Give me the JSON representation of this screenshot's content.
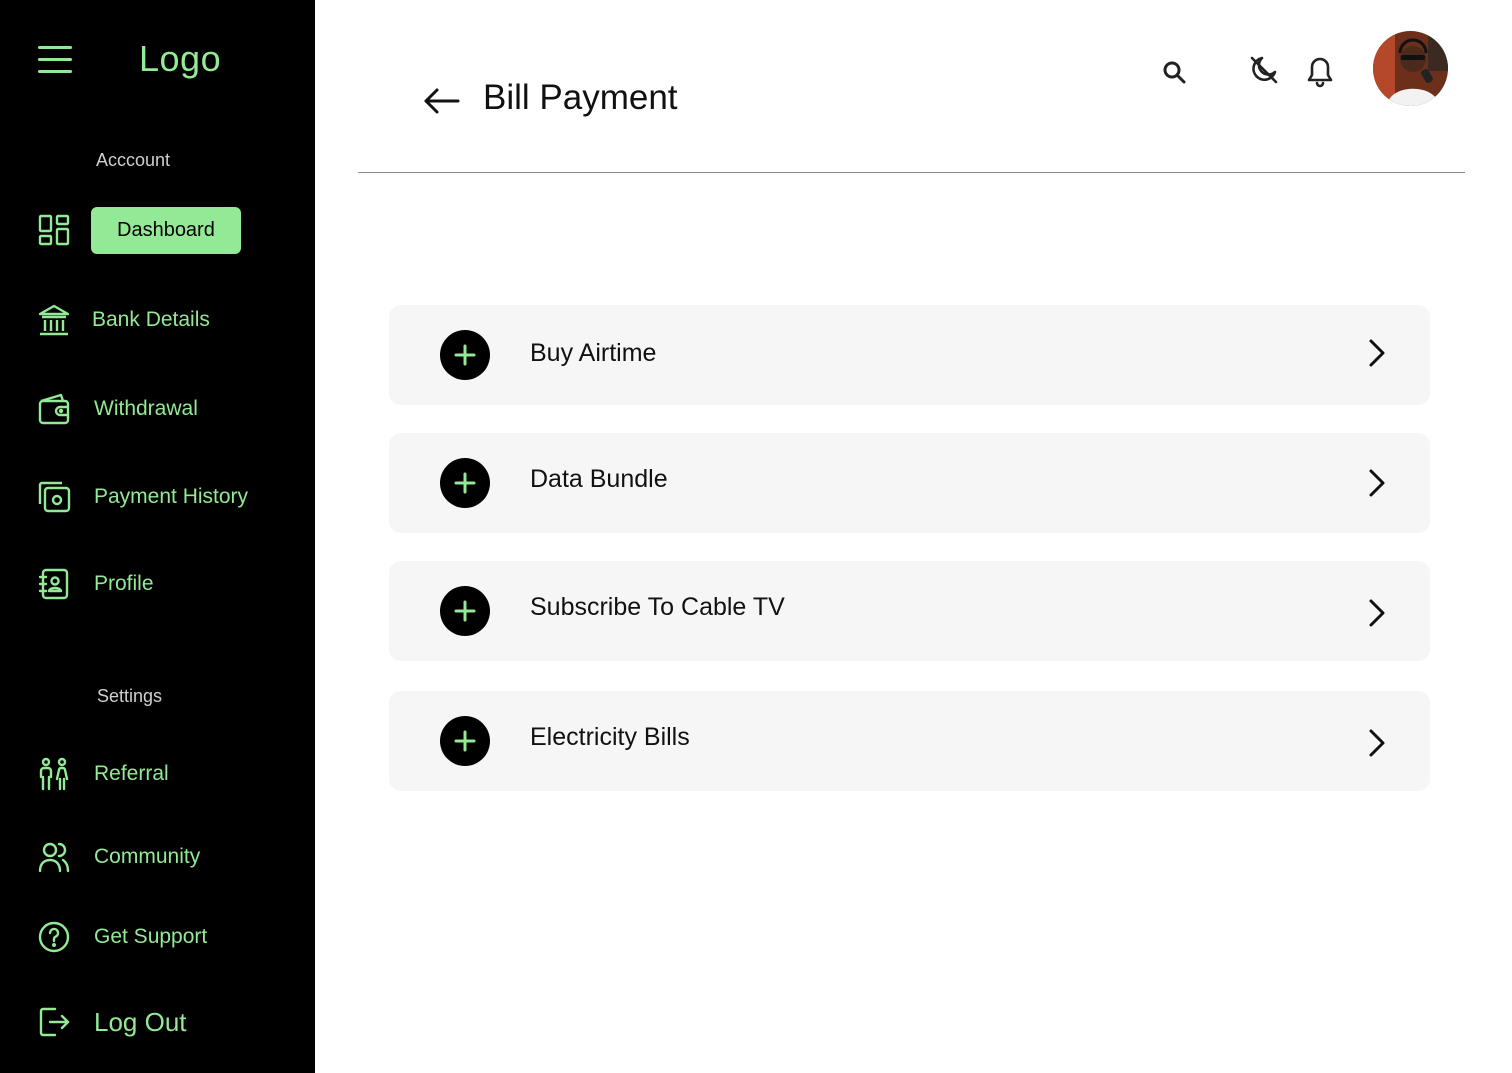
{
  "sidebar": {
    "logo": "Logo",
    "account_label": "Acccount",
    "settings_label": "Settings",
    "items": [
      {
        "label": "Dashboard",
        "icon": "dashboard-icon",
        "active": true
      },
      {
        "label": "Bank Details",
        "icon": "bank-icon"
      },
      {
        "label": "Withdrawal",
        "icon": "wallet-icon"
      },
      {
        "label": "Payment History",
        "icon": "payment-history-icon"
      },
      {
        "label": "Profile",
        "icon": "contact-book-icon"
      }
    ],
    "settings_items": [
      {
        "label": "Referral",
        "icon": "people-icon"
      },
      {
        "label": "Community",
        "icon": "users-icon"
      },
      {
        "label": "Get Support",
        "icon": "help-circle-icon"
      }
    ],
    "logout": {
      "label": "Log Out",
      "icon": "logout-icon"
    }
  },
  "header": {
    "title": "Bill Payment",
    "icons": [
      "back-arrow-icon",
      "search-icon",
      "dark-mode-icon",
      "bell-icon",
      "avatar"
    ]
  },
  "bills": [
    {
      "label": "Buy Airtime"
    },
    {
      "label": "Data Bundle"
    },
    {
      "label": "Subscribe To Cable TV"
    },
    {
      "label": "Electricity Bills"
    }
  ],
  "colors": {
    "accent": "#93e995",
    "sidebar_bg": "#000000",
    "card_bg": "#f6f6f6",
    "text": "#111111"
  }
}
